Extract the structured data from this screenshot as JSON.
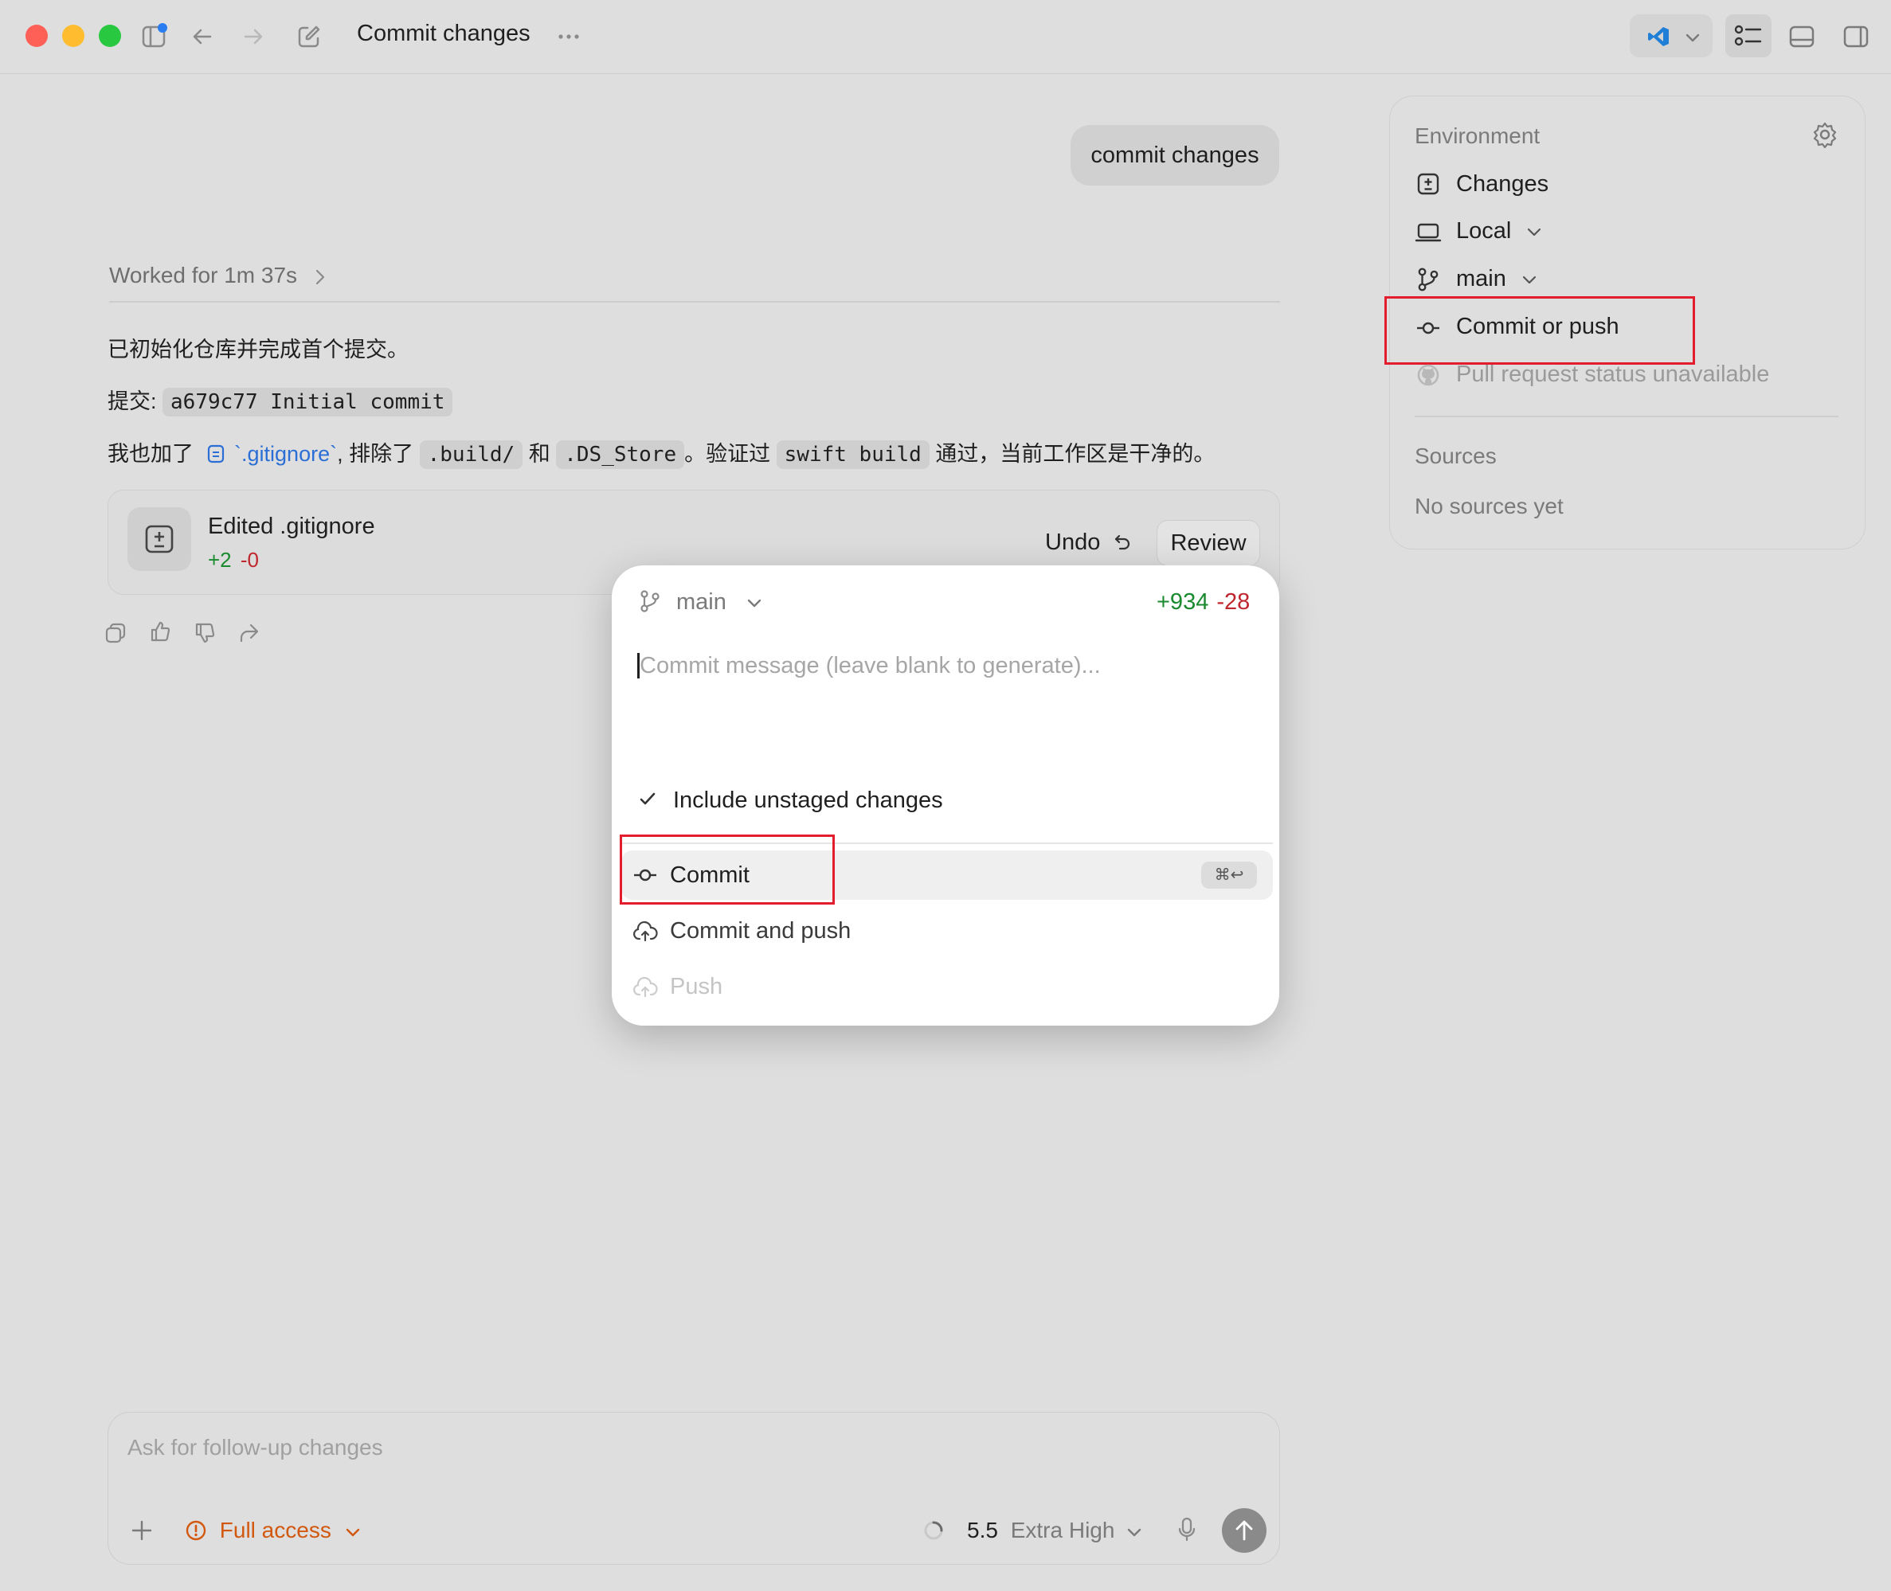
{
  "window": {
    "title": "Commit changes"
  },
  "chat": {
    "user_message": "commit changes",
    "worked_for": "Worked for 1m 37s",
    "line1": "已初始化仓库并完成首个提交。",
    "line2_prefix": "提交:",
    "line2_code": "a679c77 Initial commit",
    "line3_a": "我也加了",
    "line3_link": "`.gitignore`",
    "line3_b": ", 排除了",
    "line3_code1": ".build/",
    "line3_c": "和",
    "line3_code2": ".DS_Store",
    "line3_d": "。验证过",
    "line3_code3": "swift build",
    "line3_e": "通过，当前工作区是干净的。"
  },
  "edit_card": {
    "title": "Edited .gitignore",
    "added": "+2",
    "removed": "-0",
    "undo_label": "Undo",
    "review_label": "Review"
  },
  "commit_popup": {
    "branch": "main",
    "added": "+934",
    "removed": "-28",
    "message_placeholder": "Commit message (leave blank to generate)...",
    "include_unstaged_label": "Include unstaged changes",
    "include_unstaged_checked": true,
    "actions": [
      {
        "label": "Commit",
        "shortcut": "⌘↩",
        "selected": true,
        "enabled": true
      },
      {
        "label": "Commit and push",
        "enabled": true
      },
      {
        "label": "Push",
        "enabled": false
      }
    ]
  },
  "environment": {
    "heading": "Environment",
    "items": [
      {
        "label": "Changes",
        "icon": "diff-icon"
      },
      {
        "label": "Local",
        "icon": "laptop-icon"
      },
      {
        "label": "main",
        "icon": "branch-icon"
      },
      {
        "label": "Commit or push",
        "icon": "commit-icon"
      },
      {
        "label": "Pull request status unavailable",
        "icon": "github-icon"
      }
    ],
    "sources_heading": "Sources",
    "sources_empty": "No sources yet"
  },
  "composer": {
    "placeholder": "Ask for follow-up changes",
    "access_label": "Full access",
    "model_version": "5.5",
    "reasoning_level": "Extra High"
  },
  "colors": {
    "added": "#1a8a2e",
    "removed": "#c0262d",
    "highlight_box": "#e31d2d",
    "access_warning": "#d2580f",
    "link": "#2a6ed6"
  }
}
